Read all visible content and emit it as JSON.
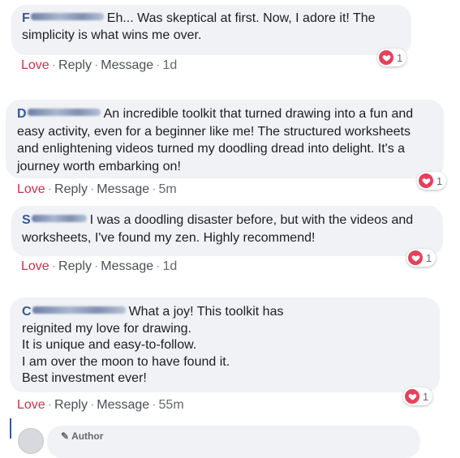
{
  "comments": [
    {
      "initial": "F",
      "text": "Eh... Was skeptical at first. Now, I adore it! The simplicity is what wins me over.",
      "love": "Love",
      "reply": "Reply",
      "message": "Message",
      "time": "1d",
      "reaction_count": "1"
    },
    {
      "initial": "D",
      "text": "An incredible toolkit that turned drawing into a fun and easy activity, even for a beginner like me! The structured worksheets and enlightening videos turned my doodling dread into delight. It's a journey worth embarking on!",
      "love": "Love",
      "reply": "Reply",
      "message": "Message",
      "time": "5m",
      "reaction_count": "1"
    },
    {
      "initial": "S",
      "text": "I was a doodling disaster before, but with the videos and worksheets, I've found my zen. Highly recommend!",
      "love": "Love",
      "reply": "Reply",
      "message": "Message",
      "time": "1d",
      "reaction_count": "1"
    },
    {
      "initial": "C",
      "text_lines": [
        "What a joy! This toolkit has reignited my love for drawing.",
        "It is unique and easy-to-follow.",
        "I am over the moon to have found it.",
        "Best investment ever!"
      ],
      "love": "Love",
      "reply": "Reply",
      "message": "Message",
      "time": "55m",
      "reaction_count": "1"
    }
  ],
  "author_badge": "Author",
  "colors": {
    "name": "#385898",
    "love": "#c9324a",
    "heart": "#e8405a",
    "bubble": "#f0f2f5"
  },
  "icons": {
    "reaction": "heart-icon",
    "author": "pencil-icon"
  }
}
